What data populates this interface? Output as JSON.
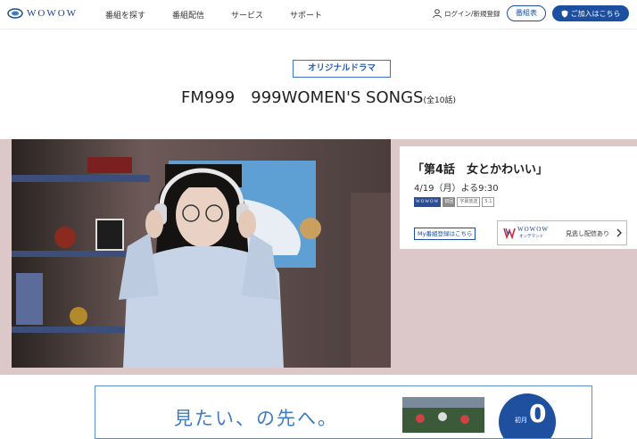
{
  "header": {
    "logo_text": "WOWOW",
    "nav": [
      "番組を探す",
      "番組配信",
      "サービス",
      "サポート"
    ],
    "login_label": "ログイン/新規登録",
    "schedule_label": "番組表",
    "join_label": "ご加入はこちら"
  },
  "title_area": {
    "badge": "オリジナルドラマ",
    "title": "FM999　999WOMEN'S SONGS",
    "episodes_total": "(全10話)"
  },
  "episode": {
    "title": "「第4話　女とかわいい」",
    "date": "4/19（月）よる9:30",
    "tags": [
      "WOWOW",
      "初回",
      "字幕放送",
      "5.1"
    ],
    "mylist_label": "My番組登録はこちら",
    "ondemand": {
      "name": "WOWOW",
      "sub": "オンデマンド",
      "label": "見逃し配信あり"
    }
  },
  "banner": {
    "text": "見たい、の先へ。",
    "circle_label": "初月",
    "circle_number": "0"
  },
  "colors": {
    "brand_blue": "#1c4fa0",
    "hero_bg": "#dcc8c8",
    "accent_blue": "#3d7cc4"
  }
}
